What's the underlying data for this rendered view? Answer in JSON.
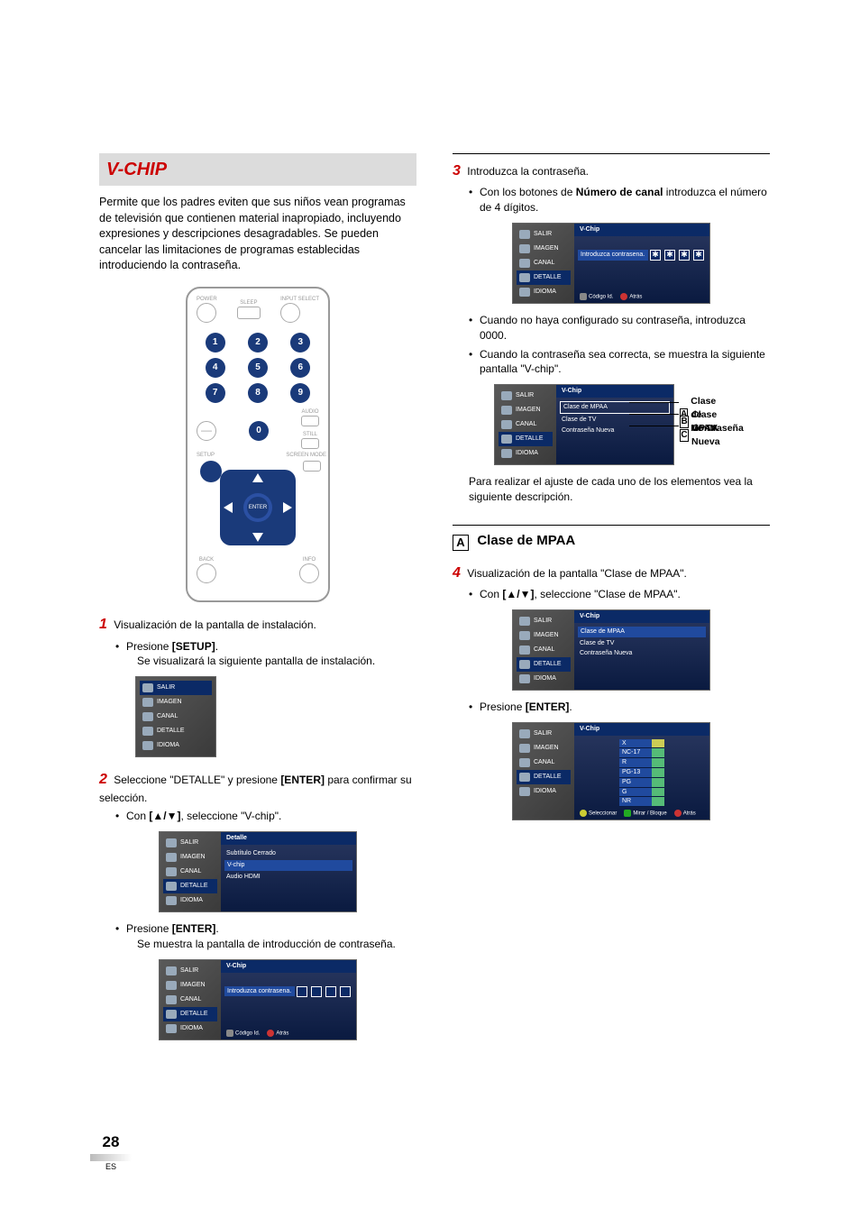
{
  "page": {
    "number": "28",
    "lang_suffix": "ES"
  },
  "title": "V-CHIP",
  "intro": "Permite que los padres eviten que sus niños vean programas de televisión que contienen material inapropiado, incluyendo expresiones y descripciones desagradables. Se pueden cancelar las limitaciones de programas establecidas introduciendo la contraseña.",
  "remote": {
    "power": "POWER",
    "sleep": "SLEEP",
    "input": "INPUT SELECT",
    "audio": "AUDIO",
    "still": "STILL",
    "setup": "SETUP",
    "screen_mode": "SCREEN MODE",
    "back": "BACK",
    "info": "INFO",
    "enter": "ENTER",
    "keys": [
      "1",
      "2",
      "3",
      "4",
      "5",
      "6",
      "7",
      "8",
      "9",
      "0"
    ],
    "dash": "—"
  },
  "steps": {
    "s1": {
      "num": "1",
      "text": "Visualización de la pantalla de instalación.",
      "b1": "Presione ",
      "b1_key": "[SETUP]",
      "b1_tail": ".",
      "b1_sub": "Se visualizará la siguiente pantalla de instalación."
    },
    "s2": {
      "num": "2",
      "text_a": "Seleccione \"DETALLE\" y presione ",
      "text_key": "[ENTER]",
      "text_b": " para confirmar su selección.",
      "b1": "Con ",
      "b1_key": "[▲/▼]",
      "b1_tail": ", seleccione \"V-chip\".",
      "b2": "Presione ",
      "b2_key": "[ENTER]",
      "b2_tail": ".",
      "b2_sub": "Se muestra la pantalla de introducción de contraseña."
    },
    "s3": {
      "num": "3",
      "text": "Introduzca la contraseña.",
      "b1": "Con los botones de ",
      "b1_key": "Número de canal",
      "b1_tail": " introduzca el número de 4 dígitos.",
      "b2": "Cuando no haya configurado su contraseña, introduzca 0000.",
      "b3": "Cuando la contraseña sea correcta, se muestra la siguiente pantalla \"V-chip\".",
      "after": "Para realizar el ajuste de cada uno de los elementos vea la siguiente descripción."
    },
    "s4": {
      "num": "4",
      "text": "Visualización de la pantalla \"Clase de MPAA\".",
      "b1": "Con ",
      "b1_key": "[▲/▼]",
      "b1_tail": ", seleccione \"Clase de MPAA\".",
      "b2": "Presione ",
      "b2_key": "[ENTER]",
      "b2_tail": "."
    }
  },
  "section": {
    "letter": "A",
    "label": "Clase de MPAA"
  },
  "callouts": {
    "A": {
      "letter": "A",
      "label": "Clase de MPAA"
    },
    "B": {
      "letter": "B",
      "label": "Clase de TV"
    },
    "C": {
      "letter": "C",
      "label": "Contraseña Nueva"
    }
  },
  "osd": {
    "side": [
      "SALIR",
      "IMAGEN",
      "CANAL",
      "DETALLE",
      "IDIOMA"
    ],
    "detalle_title": "Detalle",
    "detalle_items": [
      "Subtítulo Cerrado",
      "V-chip",
      "Audio HDMI"
    ],
    "vchip_title": "V-Chip",
    "pw_label": "Introduzca contrasena.",
    "pw_star": "✱",
    "foot_codigo": "Código Id.",
    "foot_atras": "Atrás",
    "foot_seleccionar": "Seleccionar",
    "foot_mirar_bloque": "Mirar / Bloque",
    "vchip_items": [
      "Clase de MPAA",
      "Clase de TV",
      "Contraseña Nueva"
    ],
    "ratings": [
      "X",
      "NC-17",
      "R",
      "PG-13",
      "PG",
      "G",
      "NR"
    ]
  }
}
